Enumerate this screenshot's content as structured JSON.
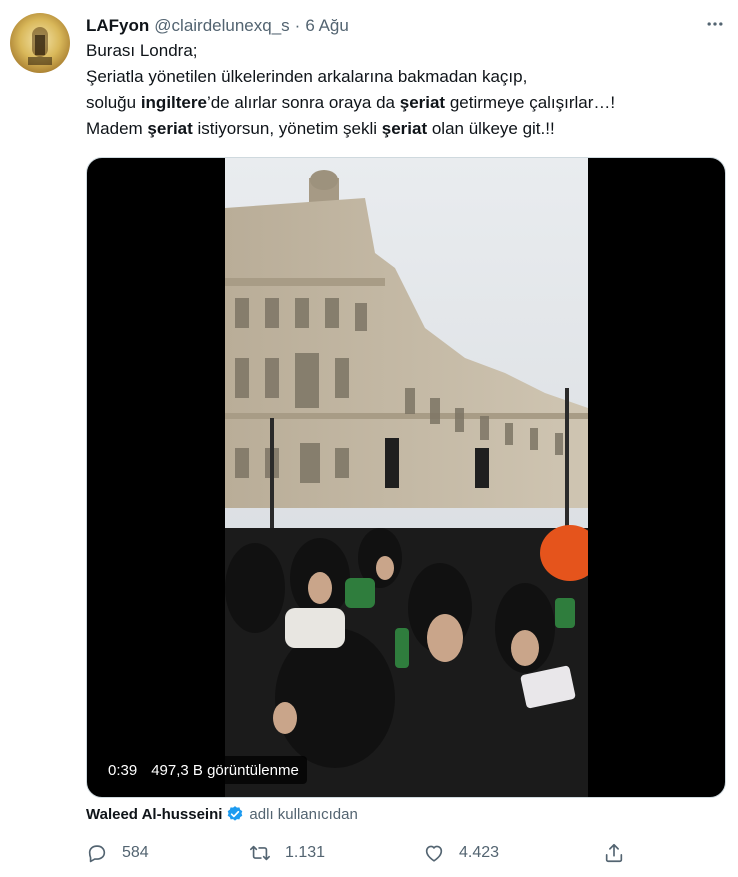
{
  "tweet": {
    "display_name": "LAFyon",
    "handle": "@clairdelunexq_s",
    "separator": "·",
    "date": "6 Ağu",
    "text": {
      "line1": "Burası Londra;",
      "line2": "Şeriatla yönetilen ülkelerinden arkalarına bakmadan kaçıp,",
      "line3_a": "soluğu ",
      "line3_b": "ingiltere",
      "line3_c": "’de alırlar sonra oraya da ",
      "line3_d": "şeriat",
      "line3_e": " getirmeye çalışırlar…!",
      "line4_a": "Madem ",
      "line4_b": "şeriat",
      "line4_c": " istiyorsun, yönetim şekli ",
      "line4_d": "şeriat",
      "line4_e": " olan ülkeye git.!!"
    }
  },
  "video": {
    "duration": "0:39",
    "views": "497,3 B görüntülenme"
  },
  "attribution": {
    "name": "Waleed Al-husseini",
    "suffix": "adlı kullanıcıdan"
  },
  "actions": {
    "replies": "584",
    "retweets": "1.131",
    "likes": "4.423"
  },
  "icons": {
    "more": "more-dots-icon",
    "verified": "verified-badge-icon",
    "reply": "reply-icon",
    "retweet": "retweet-icon",
    "like": "heart-icon",
    "share": "share-icon"
  },
  "colors": {
    "text_primary": "#0f1419",
    "text_secondary": "#536471",
    "verified_blue": "#1d9bf0",
    "media_border": "#cfd9de"
  }
}
